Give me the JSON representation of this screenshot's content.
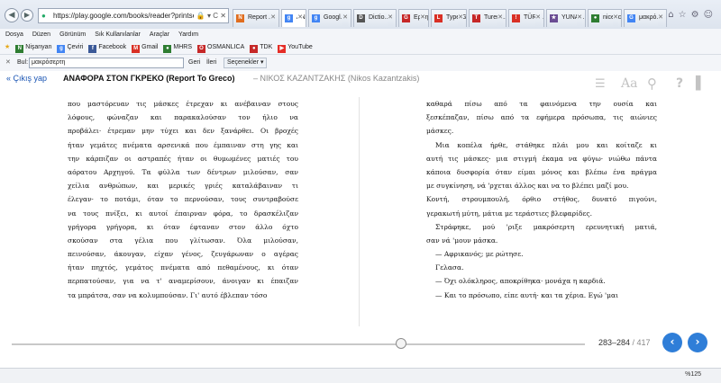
{
  "browser": {
    "address": "https://play.google.com/books/reader?printsec=fr",
    "tabs": [
      {
        "label": "Report ...",
        "fav": "N",
        "color": "#e06d1f"
      },
      {
        "label": "AN...",
        "fav": "g",
        "color": "#4285f4"
      },
      {
        "label": "Googl...",
        "fav": "g",
        "color": "#4285f4"
      },
      {
        "label": "Dictio...",
        "fav": "D",
        "color": "#555555"
      },
      {
        "label": "Ερμην...",
        "fav": "G",
        "color": "#c62828"
      },
      {
        "label": "Type G...",
        "fav": "L",
        "color": "#d93025"
      },
      {
        "label": "Turen...",
        "fav": "T",
        "color": "#c62828"
      },
      {
        "label": "TÜRK ...",
        "fav": "!",
        "color": "#d93025"
      },
      {
        "label": "YUNA...",
        "fav": "★",
        "color": "#6a4c93"
      },
      {
        "label": "nice, c...",
        "fav": "●",
        "color": "#2e7d32"
      },
      {
        "label": "μακρό...",
        "fav": "G",
        "color": "#4285f4"
      }
    ],
    "menu": [
      "Dosya",
      "Düzen",
      "Görünüm",
      "Sık Kullanılanlar",
      "Araçlar",
      "Yardım"
    ],
    "favorites": [
      {
        "label": "Nişanyan",
        "ic": "N",
        "color": "#2e7d32"
      },
      {
        "label": "Çeviri",
        "ic": "g",
        "color": "#4285f4"
      },
      {
        "label": "Facebook",
        "ic": "f",
        "color": "#3b5998"
      },
      {
        "label": "Gmail",
        "ic": "M",
        "color": "#d93025"
      },
      {
        "label": "MHRS",
        "ic": "●",
        "color": "#2e7d32"
      },
      {
        "label": "OSMANLICA",
        "ic": "O",
        "color": "#c62828"
      },
      {
        "label": "TDK",
        "ic": "●",
        "color": "#c62828"
      },
      {
        "label": "YouTube",
        "ic": "▶",
        "color": "#e52d27"
      }
    ],
    "find": {
      "label": "Bul:",
      "value": "μακρόσερτη",
      "prev": "Geri",
      "next": "İleri",
      "options": "Seçenekler ▾"
    },
    "zoom": "%125"
  },
  "reader": {
    "back": "« Çıkış yap",
    "title": "ΑΝΑΦΟΡΑ ΣΤΟΝ ΓΚΡΕΚΟ (Report To Greco)",
    "author": "– ΝΙΚΟΣ ΚΑΖΑΝΤΖΑΚΗΣ (Nikos Kazantzakis)",
    "left_lines": [
      "που μαστόρευαν τις μάσκες έτρεχαν κι ανέβαιναν στους",
      "λόφους, φώναζαν και παρακαλούσαν τον ήλιο να",
      "προβάλει· έτρεμαν μην τύχει και δεν ξανάρθει. Οι βροχές",
      "ήταν γεμάτες πνέματα αρσενικά που έμπαιναν στη γης και",
      "την κάρπιζαν οι αστραπές ήταν οι θυμωμένες ματιές του",
      "αόρατου Αρχηγού. Τα φύλλα των δέντρων μιλούσαν, σαν",
      "χείλια ανθρώπων, και μερικές γριές καταλάβαιναν τι",
      "έλεγαν· το ποτάμι, όταν το περνούσαν, τους συντραβούσε",
      "να τους πνίξει, κι αυτοί έπαιρναν φόρα, το δρασκέλιζαν",
      "γρήγορα γρήγορα, κι όταν έφταναν στον άλλο όχτο",
      "σκούσαν στα γέλια που γλίτωσαν. Όλα μιλούσαν,",
      "πεινούσαν, άκουγαν, είχαν γένος, ζευγάρωναν ο αγέρας",
      "ήταν πηχτός, γεμάτος πνέματα από πεθαμένους, κι όταν",
      "περπατούσαν, για να τ' αναμερίσουν, άνοιγαν κι έπαιζαν",
      "τα μπράτσα, σαν να κολυμπούσαν. Γι' αυτό έβλεπαν τόσο"
    ],
    "right_lines": [
      "καθαρά πίσω από τα φαινόμενα την ουσία και",
      "ξεσκέπαζαν, πίσω από τα εφήμερα πρόσωπα, τις αιώνιες",
      "μάσκες.",
      "Μια κοπέλα ήρθε, στάθηκε πλάι μου και κοίταζε κι",
      "αυτή τις μάσκες· μια στιγμή έκαμα να φύγω· νιώθω πάντα",
      "κάποια δυσφορία όταν είμαι μόνος και βλέπω ένα πράγμα",
      "με συγκίνηση, νά 'ρχεται άλλος και να το βλέπει μαζί μου.",
      "Κοντή, στρουμπουλή, όρθιο στήθος, δυνατό πιγούνι,",
      "γερακωτή μύτη, μάτια με τεράστιες βλεφαρίδες.",
      "Στράφηκε, μού 'ριξε μακρόσερτη ερευνητική ματιά,",
      "σαν νά 'μουν μάσκα.",
      "— Αφρικανός; με ρώτησε.",
      "Γελασα.",
      "— Όχι ολόκληρος, αποκρίθηκα· μονάχα η καρδιά.",
      "— Και το πρόσωπο, είπε αυτή· και τα χέρια. Εγώ 'μαι"
    ],
    "progress": 0.68,
    "page_range": "283–284",
    "page_total": " / 417"
  }
}
